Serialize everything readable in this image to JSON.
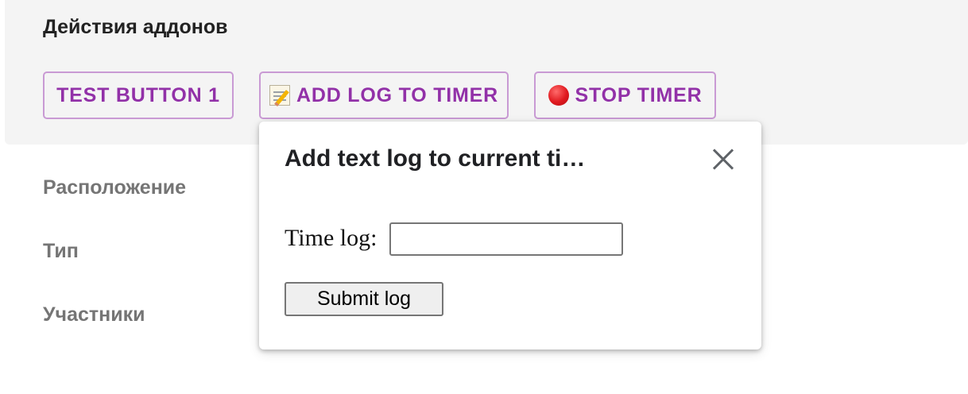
{
  "addons_panel": {
    "title": "Действия аддонов",
    "buttons": [
      {
        "label": "TEST BUTTON 1",
        "icon": ""
      },
      {
        "label": "ADD LOG TO TIMER",
        "icon": "memo-icon"
      },
      {
        "label": "STOP TIMER",
        "icon": "red-circle-icon"
      }
    ]
  },
  "event_fields": {
    "location_label": "Расположение",
    "type_label": "Тип",
    "participants_label": "Участники"
  },
  "popup": {
    "title": "Add text log to current ti…",
    "close_icon": "close-icon",
    "time_log_label": "Time log:",
    "time_log_value": "",
    "submit_label": "Submit log"
  },
  "colors": {
    "accent": "#9231a8",
    "button_border": "#c99ad4",
    "panel_background": "#f4f4f4",
    "muted_label": "#757575"
  }
}
